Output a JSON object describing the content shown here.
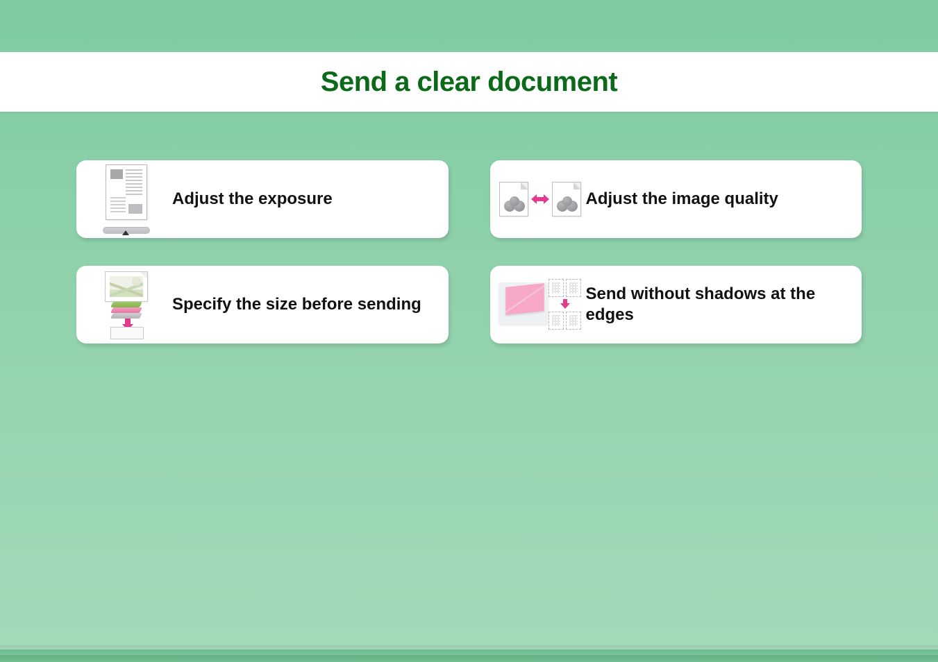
{
  "header": {
    "title": "Send a clear document"
  },
  "options": [
    {
      "label": "Adjust the exposure"
    },
    {
      "label": "Adjust the image quality"
    },
    {
      "label": "Specify the size before sending"
    },
    {
      "label": "Send without shadows at the edges"
    }
  ],
  "colors": {
    "title": "#0a6a19",
    "accent_pink": "#e23a8d",
    "bg_from": "#7ecba1",
    "bg_to": "#a3dab9"
  }
}
